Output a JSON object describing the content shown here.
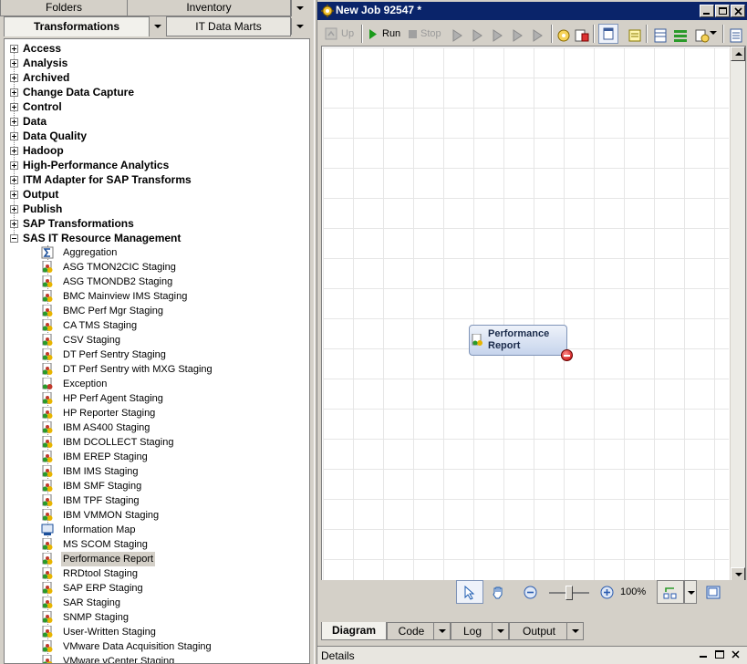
{
  "left_panel": {
    "top_tabs": [
      "Folders",
      "Inventory"
    ],
    "second_tabs": [
      "Transformations",
      "IT Data Marts"
    ],
    "tree": {
      "groups": [
        "Access",
        "Analysis",
        "Archived",
        "Change Data Capture",
        "Control",
        "Data",
        "Data Quality",
        "Hadoop",
        "High-Performance Analytics",
        "ITM Adapter for SAP Transforms",
        "Output",
        "Publish",
        "SAP Transformations",
        "SAS IT Resource Management"
      ],
      "expanded_group": "SAS IT Resource Management",
      "items": [
        {
          "label": "Aggregation",
          "icon": "sigma-icon"
        },
        {
          "label": "ASG TMON2CIC Staging",
          "icon": "transform-icon"
        },
        {
          "label": "ASG TMONDB2 Staging",
          "icon": "transform-icon"
        },
        {
          "label": "BMC Mainview IMS Staging",
          "icon": "transform-icon"
        },
        {
          "label": "BMC Perf Mgr Staging",
          "icon": "transform-icon"
        },
        {
          "label": "CA TMS Staging",
          "icon": "transform-icon"
        },
        {
          "label": "CSV Staging",
          "icon": "transform-icon"
        },
        {
          "label": "DT Perf Sentry Staging",
          "icon": "transform-icon"
        },
        {
          "label": "DT Perf Sentry with MXG Staging",
          "icon": "transform-icon"
        },
        {
          "label": "Exception",
          "icon": "exception-icon"
        },
        {
          "label": "HP Perf Agent Staging",
          "icon": "transform-icon"
        },
        {
          "label": "HP Reporter Staging",
          "icon": "transform-icon"
        },
        {
          "label": "IBM AS400 Staging",
          "icon": "transform-icon"
        },
        {
          "label": "IBM DCOLLECT Staging",
          "icon": "transform-icon"
        },
        {
          "label": "IBM EREP Staging",
          "icon": "transform-icon"
        },
        {
          "label": "IBM IMS Staging",
          "icon": "transform-icon"
        },
        {
          "label": "IBM SMF Staging",
          "icon": "transform-icon"
        },
        {
          "label": "IBM TPF Staging",
          "icon": "transform-icon"
        },
        {
          "label": "IBM VMMON Staging",
          "icon": "transform-icon"
        },
        {
          "label": "Information Map",
          "icon": "information-map-icon"
        },
        {
          "label": "MS SCOM Staging",
          "icon": "transform-icon"
        },
        {
          "label": "Performance Report",
          "icon": "transform-icon",
          "selected": true
        },
        {
          "label": "RRDtool Staging",
          "icon": "transform-icon"
        },
        {
          "label": "SAP ERP Staging",
          "icon": "transform-icon"
        },
        {
          "label": "SAR Staging",
          "icon": "transform-icon"
        },
        {
          "label": "SNMP Staging",
          "icon": "transform-icon"
        },
        {
          "label": "User-Written Staging",
          "icon": "transform-icon"
        },
        {
          "label": "VMware Data Acquisition Staging",
          "icon": "transform-icon"
        },
        {
          "label": "VMware vCenter Staging",
          "icon": "transform-icon"
        }
      ]
    }
  },
  "job_window": {
    "title": "New Job 92547 *",
    "toolbar": {
      "up": "Up",
      "run": "Run",
      "stop": "Stop"
    },
    "diagram_node": {
      "line1": "Performance",
      "line2": "Report"
    },
    "zoom_level": 0.5,
    "zoom_text": "100%",
    "bottom_tabs": [
      "Diagram",
      "Code",
      "Log",
      "Output"
    ]
  },
  "details": {
    "title": "Details"
  },
  "colors": {
    "titlebar": "#0a246a",
    "selection": "#d4d0c8",
    "node_border": "#7f94b8",
    "port": "#c00000",
    "run_green": "#1a9a1a"
  }
}
